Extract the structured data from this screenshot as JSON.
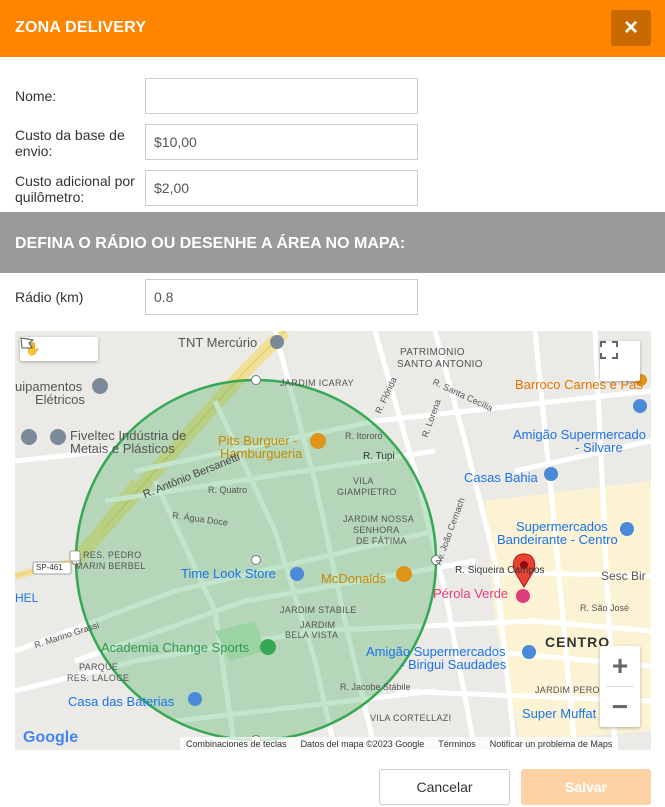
{
  "header": {
    "title": "ZONA DELIVERY",
    "close_label": "×"
  },
  "form": {
    "name_label": "Nome:",
    "name_value": "",
    "base_cost_label": "Custo da base de envio:",
    "base_cost_value": "$10,00",
    "extra_cost_label": "Custo adicional por quilômetro:",
    "extra_cost_value": "$2,00"
  },
  "section": {
    "title": "DEFINA O RÁDIO OU DESENHE A ÁREA NO MAPA:"
  },
  "radius": {
    "label": "Rádio (km)",
    "value": "0.8"
  },
  "map": {
    "places": [
      {
        "id": "tnt",
        "text": "TNT Mercúrio"
      },
      {
        "id": "patrimonio",
        "text": "PATRIMONIO"
      },
      {
        "id": "santo-antonio",
        "text": "SANTO ANTONIO"
      },
      {
        "id": "barroco",
        "text": "Barroco Carnes e Pas"
      },
      {
        "id": "equipamentos1",
        "text": "uipamentos"
      },
      {
        "id": "equipamentos2",
        "text": "Elétricos"
      },
      {
        "id": "jardim-icaray",
        "text": "JARDIM ICARAY"
      },
      {
        "id": "r-florida",
        "text": "R. Flórida"
      },
      {
        "id": "r-santa-cecilia",
        "text": "R. Santa Cecília"
      },
      {
        "id": "r-lorena",
        "text": "R. Lorena"
      },
      {
        "id": "fiveltec1",
        "text": "Fiveltec Indústria de"
      },
      {
        "id": "fiveltec2",
        "text": "Metais e Plásticos"
      },
      {
        "id": "pits1",
        "text": "Pits Burguer -"
      },
      {
        "id": "pits2",
        "text": "Hamburgueria"
      },
      {
        "id": "r-itororo",
        "text": "R. Itororó"
      },
      {
        "id": "amigao-silvares1",
        "text": "Amigão Supermercado"
      },
      {
        "id": "amigao-silvares2",
        "text": "- Silvare"
      },
      {
        "id": "r-tupi",
        "text": "R. Tupi"
      },
      {
        "id": "bersanetti",
        "text": "R. Antônio Bersanetti"
      },
      {
        "id": "casas-bahia",
        "text": "Casas Bahia"
      },
      {
        "id": "r-quatro",
        "text": "R. Quatro"
      },
      {
        "id": "vila-giampietro1",
        "text": "VILA"
      },
      {
        "id": "vila-giampietro2",
        "text": "GIAMPIETRO"
      },
      {
        "id": "r-agua-doce",
        "text": "R. Água Doce"
      },
      {
        "id": "av-joao-cernach",
        "text": "Av. João Cernach"
      },
      {
        "id": "jardim-nossa1",
        "text": "JARDIM NOSSA"
      },
      {
        "id": "jardim-nossa2",
        "text": "SENHORA"
      },
      {
        "id": "jardim-nossa3",
        "text": "DE FÁTIMA"
      },
      {
        "id": "bandeirante1",
        "text": "Supermercados"
      },
      {
        "id": "bandeirante2",
        "text": "Bandeirante - Centro"
      },
      {
        "id": "res-pedro1",
        "text": "RES. PEDRO"
      },
      {
        "id": "res-pedro2",
        "text": "MARIN BERBEL"
      },
      {
        "id": "sp461",
        "text": "SP-461"
      },
      {
        "id": "time-look",
        "text": "Time Look Store"
      },
      {
        "id": "mcdonalds",
        "text": "McDonalds"
      },
      {
        "id": "r-siqueira",
        "text": "R. Siqueira Campos"
      },
      {
        "id": "sesc",
        "text": "Sesc Bir"
      },
      {
        "id": "hel",
        "text": "HEL"
      },
      {
        "id": "perola",
        "text": "Pérola Verde"
      },
      {
        "id": "jardim-stabile",
        "text": "JARDIM STABILE"
      },
      {
        "id": "r-sao-jose",
        "text": "R. São José"
      },
      {
        "id": "r-marino",
        "text": "R. Marino Grassi"
      },
      {
        "id": "jardim-bela1",
        "text": "JARDIM"
      },
      {
        "id": "jardim-bela2",
        "text": "BELA VISTA"
      },
      {
        "id": "centro",
        "text": "CENTRO"
      },
      {
        "id": "academia",
        "text": "Academia Change Sports"
      },
      {
        "id": "amigao-saudades1",
        "text": "Amigão Supermercados"
      },
      {
        "id": "amigao-saudades2",
        "text": "- Birigui Saudades"
      },
      {
        "id": "parque1",
        "text": "PARQUE"
      },
      {
        "id": "parque2",
        "text": "RES. LALOCE"
      },
      {
        "id": "r-jacobe",
        "text": "R. Jacobe Stábile"
      },
      {
        "id": "jardim-perolo",
        "text": "JARDIM PEROL"
      },
      {
        "id": "casa-baterias",
        "text": "Casa das Baterias"
      },
      {
        "id": "vila-cortellazi",
        "text": "VILA CORTELLAZI"
      },
      {
        "id": "super-muffato",
        "text": "Super Muffat"
      }
    ],
    "google_logo": "Google",
    "footer": {
      "shortcuts": "Combinaciones de teclas",
      "data": "Datos del mapa ©2023 Google",
      "terms": "Términos",
      "report": "Notificar un problema de Maps"
    },
    "zoom_in": "+",
    "zoom_out": "−"
  },
  "buttons": {
    "cancel": "Cancelar",
    "save": "Salvar"
  },
  "colors": {
    "accent": "#ff8500",
    "section": "#9a9a9a",
    "circle": "#34a853",
    "save_disabled": "#ffd2a6"
  }
}
